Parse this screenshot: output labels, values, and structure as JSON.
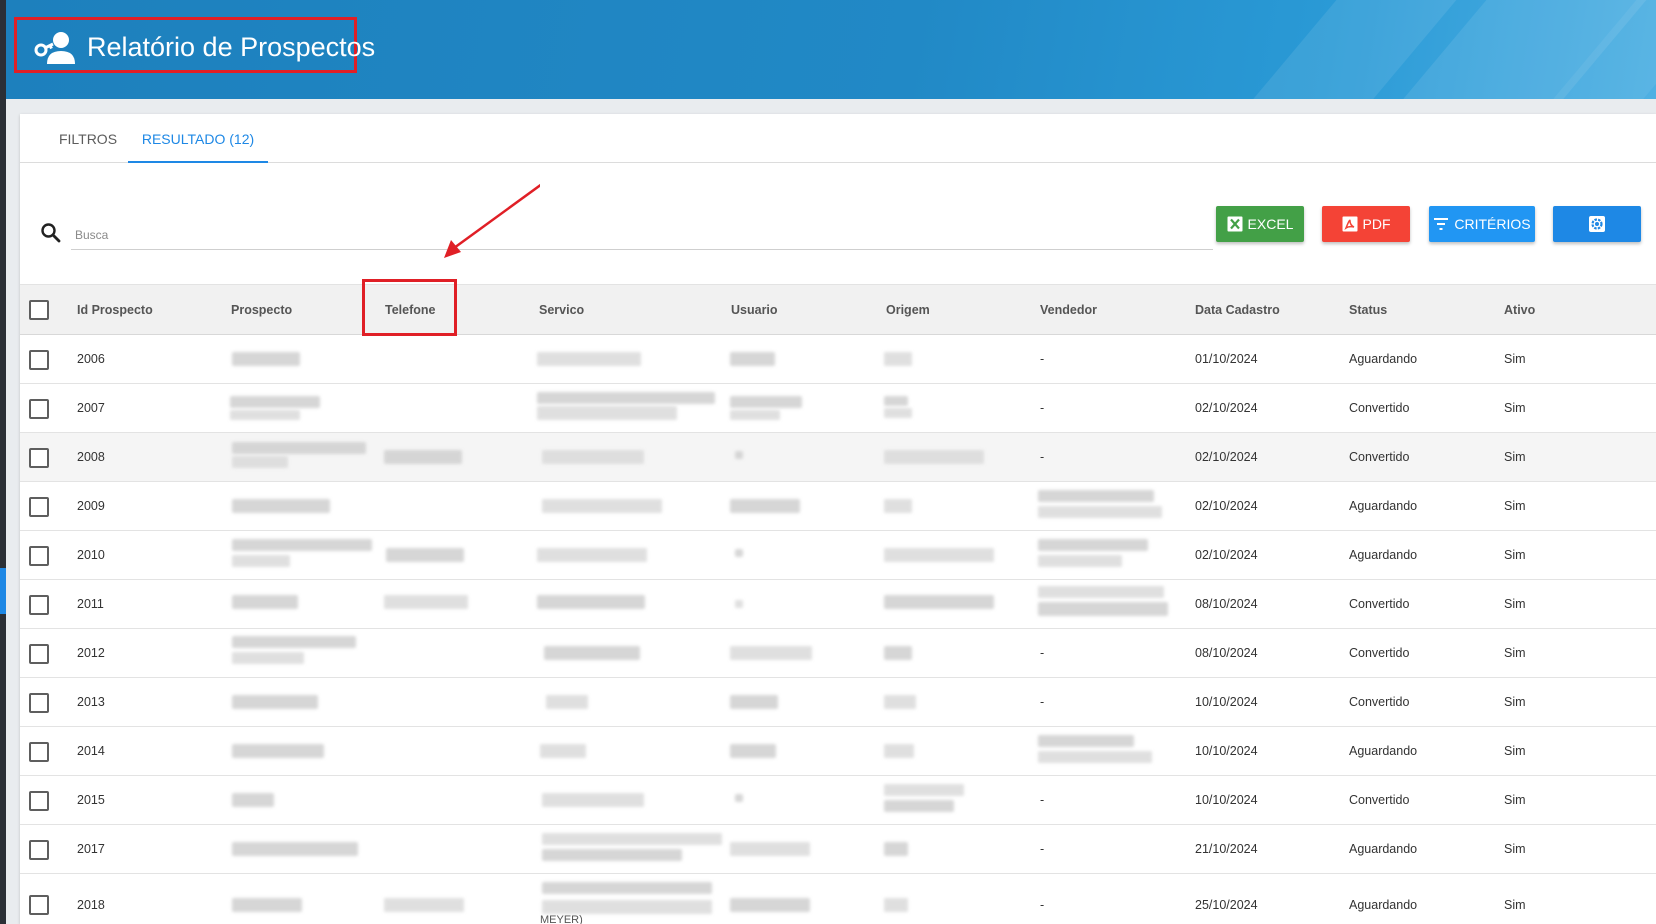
{
  "header": {
    "title": "Relatório de Prospectos",
    "icon": "user-key-icon"
  },
  "tabs": [
    {
      "label": "FILTROS",
      "active": false
    },
    {
      "label": "RESULTADO (12)",
      "active": true
    }
  ],
  "search": {
    "placeholder": "Busca",
    "value": ""
  },
  "toolbar": {
    "excel_label": "EXCEL",
    "pdf_label": "PDF",
    "criteria_label": "CRITÉRIOS"
  },
  "colors": {
    "header_bg": "#2189c6",
    "accent": "#1e88e5",
    "excel": "#43a047",
    "pdf": "#f44336",
    "criteria": "#2196f3",
    "annotation": "#e01f26"
  },
  "table": {
    "columns": [
      "Id Prospecto",
      "Prospecto",
      "Telefone",
      "Servico",
      "Usuario",
      "Origem",
      "Vendedor",
      "Data Cadastro",
      "Status",
      "Ativo"
    ],
    "rows": [
      {
        "id": "2006",
        "vendedor": "-",
        "data": "01/10/2024",
        "status": "Aguardando",
        "ativo": "Sim"
      },
      {
        "id": "2007",
        "vendedor": "-",
        "data": "02/10/2024",
        "status": "Convertido",
        "ativo": "Sim"
      },
      {
        "id": "2008",
        "vendedor": "-",
        "data": "02/10/2024",
        "status": "Convertido",
        "ativo": "Sim"
      },
      {
        "id": "2009",
        "vendedor": "",
        "data": "02/10/2024",
        "status": "Aguardando",
        "ativo": "Sim"
      },
      {
        "id": "2010",
        "vendedor": "",
        "data": "02/10/2024",
        "status": "Aguardando",
        "ativo": "Sim"
      },
      {
        "id": "2011",
        "vendedor": "",
        "data": "08/10/2024",
        "status": "Convertido",
        "ativo": "Sim"
      },
      {
        "id": "2012",
        "vendedor": "-",
        "data": "08/10/2024",
        "status": "Convertido",
        "ativo": "Sim"
      },
      {
        "id": "2013",
        "vendedor": "-",
        "data": "10/10/2024",
        "status": "Convertido",
        "ativo": "Sim"
      },
      {
        "id": "2014",
        "vendedor": "",
        "data": "10/10/2024",
        "status": "Aguardando",
        "ativo": "Sim"
      },
      {
        "id": "2015",
        "vendedor": "-",
        "data": "10/10/2024",
        "status": "Convertido",
        "ativo": "Sim"
      },
      {
        "id": "2017",
        "vendedor": "-",
        "data": "21/10/2024",
        "status": "Aguardando",
        "ativo": "Sim"
      },
      {
        "id": "2018",
        "vendedor": "-",
        "data": "25/10/2024",
        "status": "Aguardando",
        "ativo": "Sim"
      }
    ],
    "cut_off_text": "MEYER)"
  }
}
